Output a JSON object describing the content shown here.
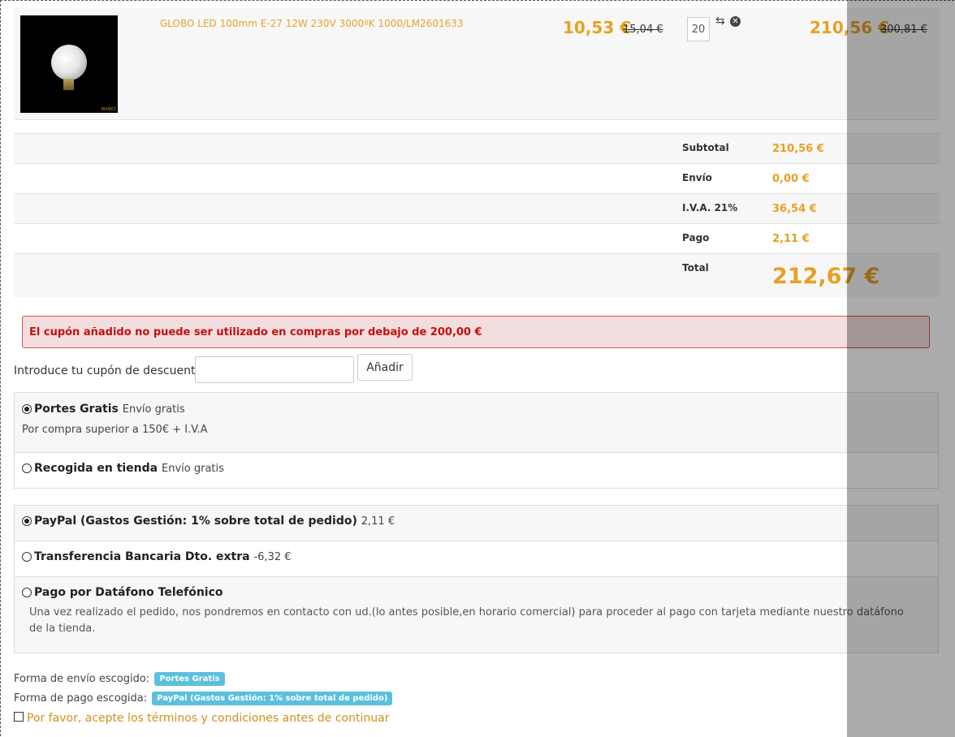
{
  "cart": {
    "product": {
      "name": "GLOBO LED 100mm E-27 12W 230V 3000ºK 1000/LM2601633",
      "unit_price": "10,53 €",
      "unit_price_old": "15,04 €",
      "quantity": "20",
      "line_total": "210,56 €",
      "line_total_old": "300,81 €",
      "image_watermark": "IBAÑEZ"
    },
    "icons": {
      "refresh": "refresh-icon",
      "remove": "remove-icon"
    }
  },
  "totals": {
    "subtotal_label": "Subtotal",
    "subtotal_value": "210,56 €",
    "shipping_label": "Envío",
    "shipping_value": "0,00 €",
    "vat_label": "I.V.A. 21%",
    "vat_value": "36,54 €",
    "payment_label": "Pago",
    "payment_value": "2,11 €",
    "total_label": "Total",
    "total_value": "212,67 €"
  },
  "alert": {
    "message": "El cupón añadido no puede ser utilizado en compras por debajo de 200,00 €"
  },
  "coupon": {
    "label": "Introduce tu cupón de descuento",
    "input_value": "",
    "button_label": "Añadir"
  },
  "shipping_options": [
    {
      "title": "Portes Gratis",
      "extra": "Envío gratis",
      "description": "Por compra superior a 150€ + I.V.A",
      "selected": true
    },
    {
      "title": "Recogida en tienda",
      "extra": "Envío gratis",
      "description": "",
      "selected": false
    }
  ],
  "payment_options": [
    {
      "title": "PayPal (Gastos Gestión: 1% sobre total de pedido)",
      "extra": "2,11 €",
      "selected": true
    },
    {
      "title": "Transferencia Bancaria Dto. extra",
      "extra": "-6,32 €",
      "selected": false
    },
    {
      "title": "Pago por Datáfono Telefónico",
      "extra": "",
      "description": "Una vez realizado el pedido, nos pondremos en contacto con ud.(lo antes posible,en horario comercial) para proceder al pago con tarjeta mediante nuestro datáfono de la tienda.",
      "selected": false
    }
  ],
  "summary": {
    "shipping_chosen_label": "Forma de envío escogido:",
    "shipping_chosen_value": "Portes Gratis",
    "payment_chosen_label": "Forma de pago escogida:",
    "payment_chosen_value": "PayPal (Gastos Gestión: 1% sobre total de pedido)",
    "terms_text": "Por favor, acepte los términos y condiciones antes de continuar",
    "terms_checked": false
  },
  "colors": {
    "accent": "#e8a022",
    "error": "#c41010",
    "badge": "#5bc0de"
  }
}
